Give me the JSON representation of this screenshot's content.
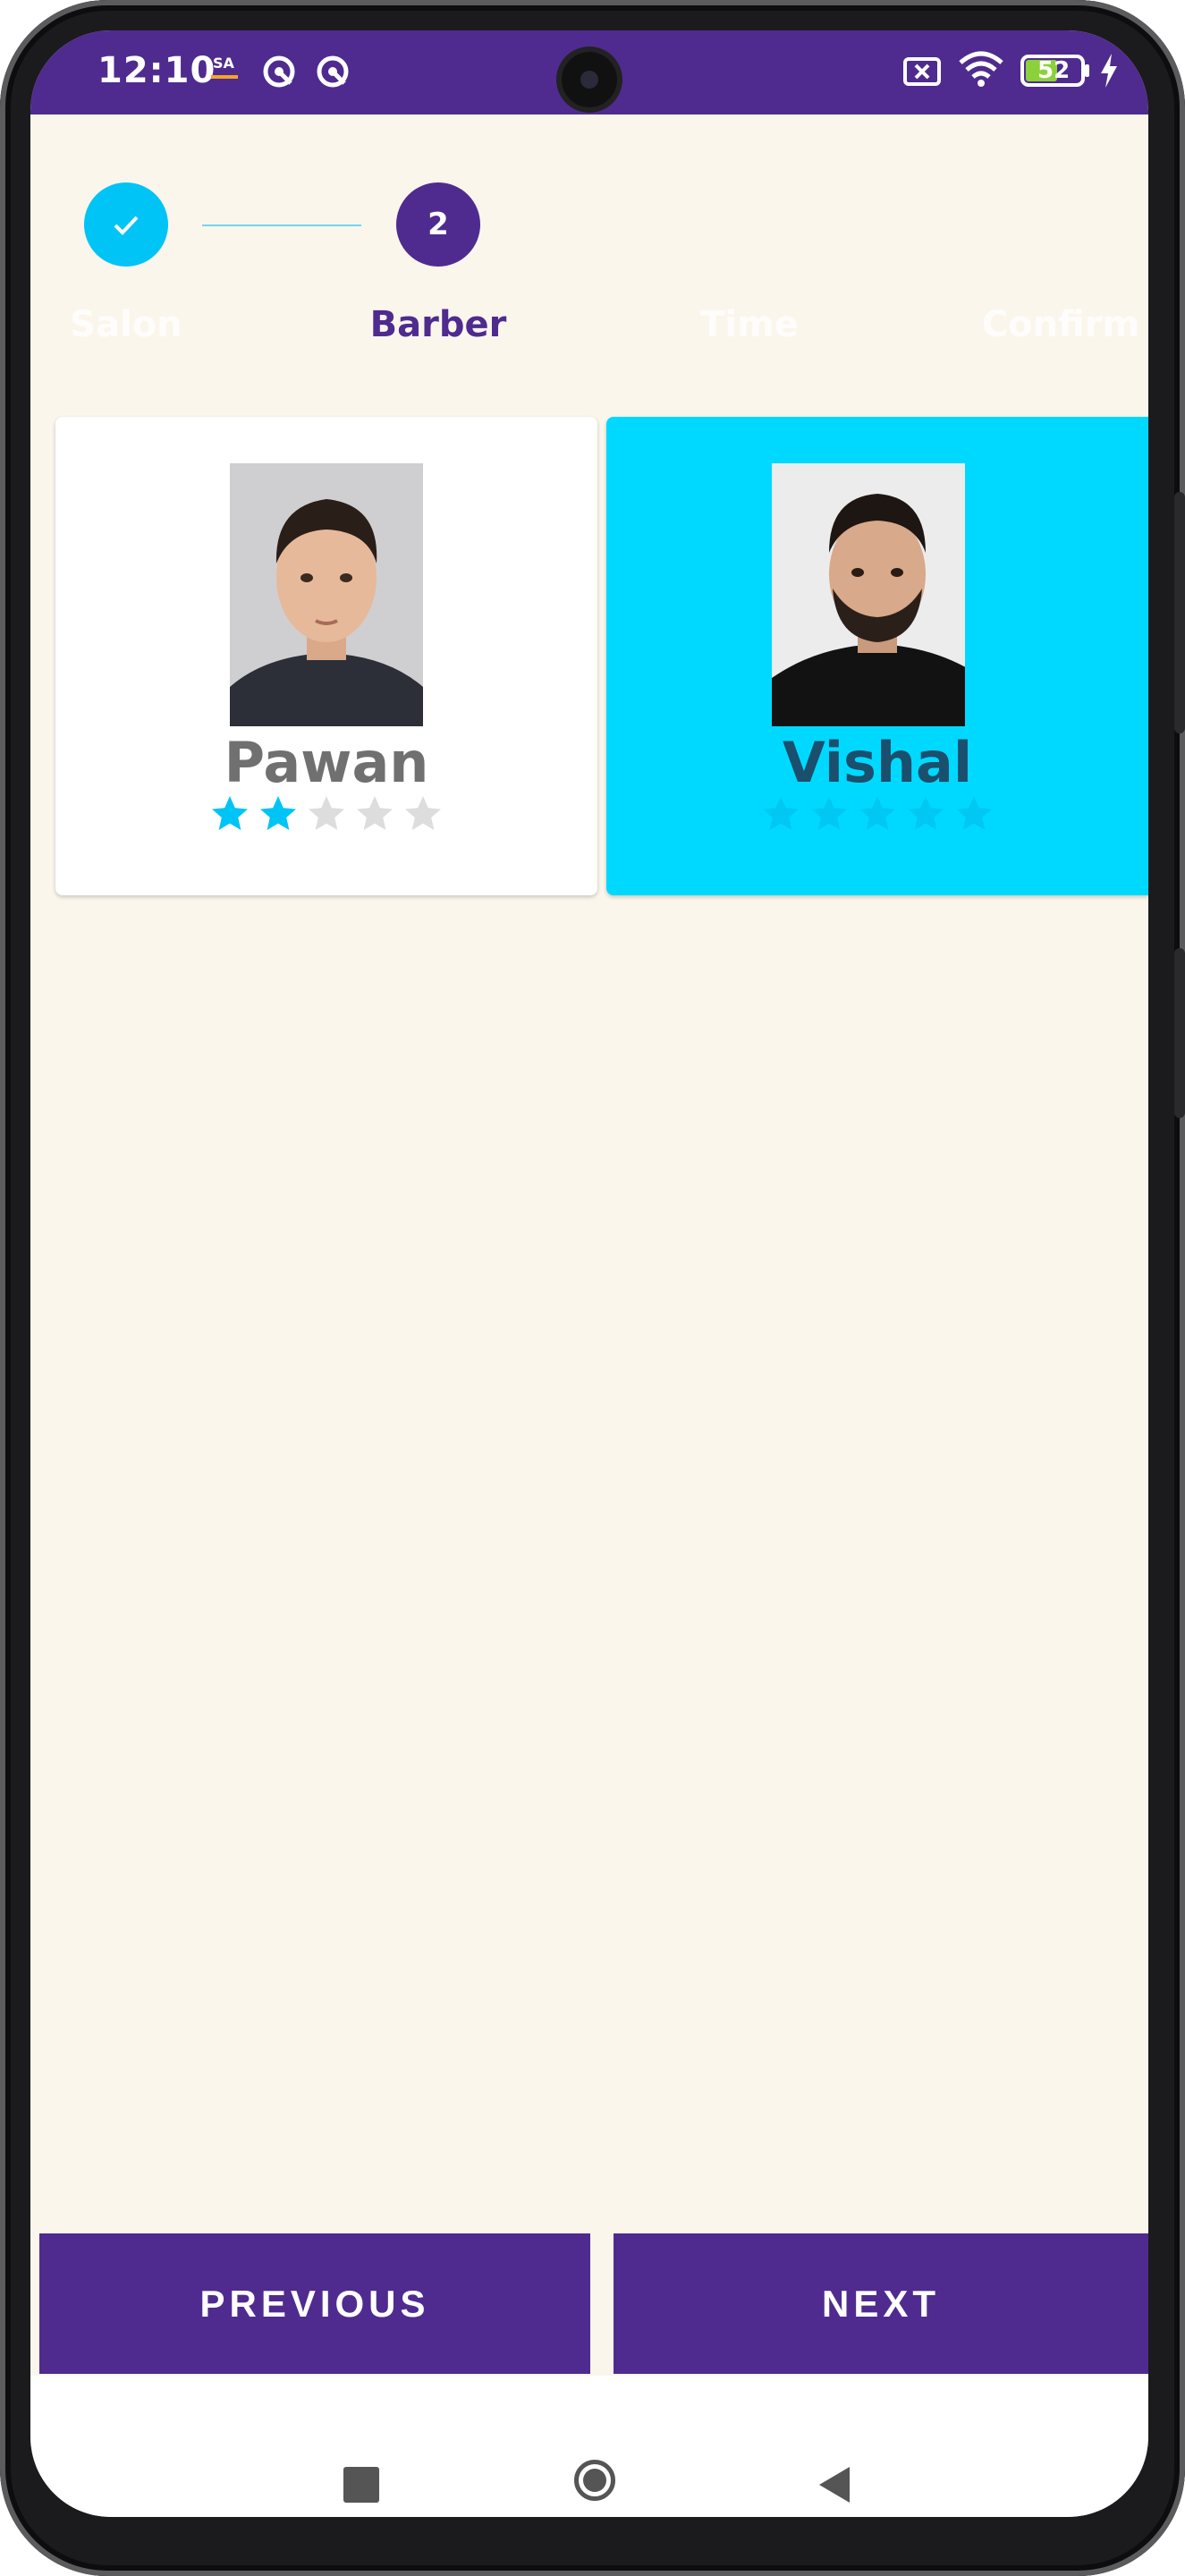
{
  "status_bar": {
    "time": "12:10",
    "battery": "52",
    "icons": [
      "app-notification-icon",
      "data-saver-icon",
      "data-saver-icon",
      "sim-off-icon",
      "wifi-icon",
      "battery-icon",
      "charging-icon"
    ]
  },
  "stepper": {
    "steps": [
      {
        "label": "Salon",
        "state": "completed",
        "marker": ""
      },
      {
        "label": "Barber",
        "state": "current",
        "marker": "2"
      },
      {
        "label": "Time",
        "state": "upcoming",
        "marker": ""
      },
      {
        "label": "Confirm",
        "state": "upcoming",
        "marker": ""
      }
    ]
  },
  "barbers": [
    {
      "name": "Pawan",
      "rating": 2,
      "max_rating": 5,
      "selected": false
    },
    {
      "name": "Vishal",
      "rating": 0,
      "max_rating": 5,
      "selected": true
    }
  ],
  "buttons": {
    "previous": "PREVIOUS",
    "next": "NEXT"
  },
  "colors": {
    "primary": "#4f2b8f",
    "accent": "#00d9ff",
    "background": "#faf6ec",
    "star_filled": "#00c4f5",
    "star_empty": "#dddddd"
  },
  "nav_icons": [
    "recents-icon",
    "home-icon",
    "back-icon"
  ]
}
